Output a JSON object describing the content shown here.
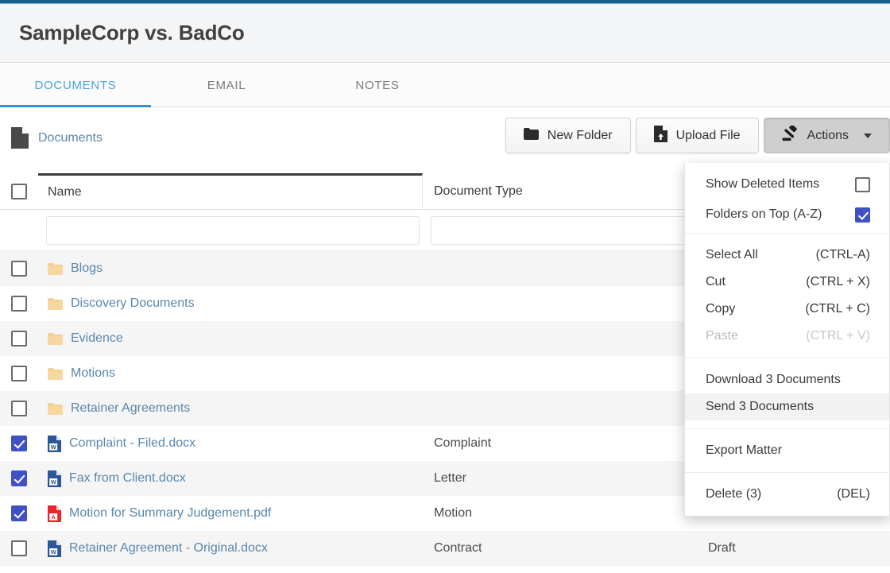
{
  "app": {
    "accent_bar_color": "#1b5e8c",
    "link_color": "#5a86ad",
    "checkbox_blue": "#3f51c5",
    "tab_active_color": "#2e92da"
  },
  "header": {
    "matter_title": "SampleCorp vs. BadCo"
  },
  "tabs": [
    {
      "label": "DOCUMENTS",
      "active": true
    },
    {
      "label": "EMAIL",
      "active": false
    },
    {
      "label": "NOTES",
      "active": false
    }
  ],
  "breadcrumb": {
    "icon": "document-icon",
    "label": "Documents"
  },
  "toolbar": {
    "new_folder_label": "New Folder",
    "new_folder_icon": "folder-icon",
    "upload_file_label": "Upload File",
    "upload_file_icon": "file-upload-icon",
    "actions_label": "Actions",
    "actions_icon": "gavel-icon",
    "actions_caret": "chevron-down-icon"
  },
  "table": {
    "columns": [
      {
        "key": "name",
        "label": "Name"
      },
      {
        "key": "type",
        "label": "Document Type"
      },
      {
        "key": "status",
        "label": ""
      }
    ],
    "filters": {
      "name": "",
      "type": "",
      "status": "",
      "placeholder": ""
    },
    "select_all_checked": false,
    "rows": [
      {
        "name": "Blogs",
        "icon": "folder-icon",
        "type": "",
        "status": "",
        "checked": false,
        "kind": "folder"
      },
      {
        "name": "Discovery Documents",
        "icon": "folder-icon",
        "type": "",
        "status": "",
        "checked": false,
        "kind": "folder"
      },
      {
        "name": "Evidence",
        "icon": "folder-icon",
        "type": "",
        "status": "",
        "checked": false,
        "kind": "folder"
      },
      {
        "name": "Motions",
        "icon": "folder-icon",
        "type": "",
        "status": "",
        "checked": false,
        "kind": "folder"
      },
      {
        "name": "Retainer Agreements",
        "icon": "folder-icon",
        "type": "",
        "status": "",
        "checked": false,
        "kind": "folder"
      },
      {
        "name": "Complaint - Filed.docx",
        "icon": "word-file-icon",
        "type": "Complaint",
        "status": "",
        "checked": true,
        "kind": "word"
      },
      {
        "name": "Fax from Client.docx",
        "icon": "word-file-icon",
        "type": "Letter",
        "status": "",
        "checked": true,
        "kind": "word"
      },
      {
        "name": "Motion for Summary Judgement.pdf",
        "icon": "pdf-file-icon",
        "type": "Motion",
        "status": "",
        "checked": true,
        "kind": "pdf"
      },
      {
        "name": "Retainer Agreement - Original.docx",
        "icon": "word-file-icon",
        "type": "Contract",
        "status": "Draft",
        "checked": false,
        "kind": "word"
      }
    ]
  },
  "actions_menu": {
    "open": true,
    "sections": [
      {
        "type": "toggles",
        "items": [
          {
            "label": "Show Deleted Items",
            "checked": false
          },
          {
            "label": "Folders on Top (A-Z)",
            "checked": true
          }
        ]
      },
      {
        "type": "commands",
        "items": [
          {
            "label": "Select All",
            "shortcut": "(CTRL-A)",
            "disabled": false,
            "hover": false
          },
          {
            "label": "Cut",
            "shortcut": "(CTRL + X)",
            "disabled": false,
            "hover": false
          },
          {
            "label": "Copy",
            "shortcut": "(CTRL + C)",
            "disabled": false,
            "hover": false
          },
          {
            "label": "Paste",
            "shortcut": "(CTRL + V)",
            "disabled": true,
            "hover": false
          }
        ]
      },
      {
        "type": "commands",
        "items": [
          {
            "label": "Download 3 Documents",
            "shortcut": "",
            "disabled": false,
            "hover": false
          },
          {
            "label": "Send 3 Documents",
            "shortcut": "",
            "disabled": false,
            "hover": true
          }
        ]
      },
      {
        "type": "commands",
        "items": [
          {
            "label": "Export Matter",
            "shortcut": "",
            "disabled": false,
            "hover": false
          }
        ]
      },
      {
        "type": "commands",
        "items": [
          {
            "label": "Delete (3)",
            "shortcut": "(DEL)",
            "disabled": false,
            "hover": false
          }
        ]
      }
    ]
  }
}
